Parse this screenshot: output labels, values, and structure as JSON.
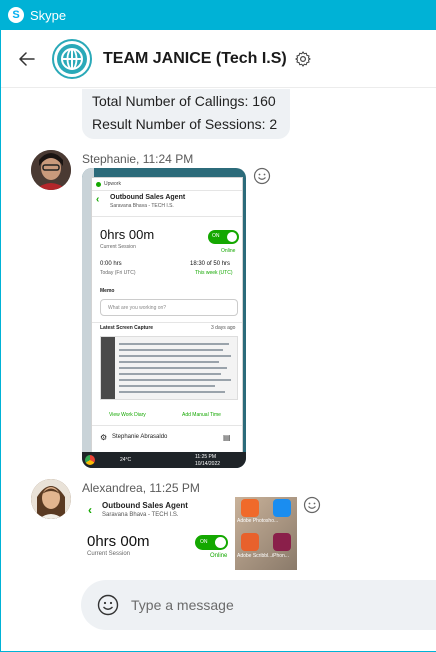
{
  "window": {
    "app_title": "Skype",
    "logo_letter": "S"
  },
  "header": {
    "group_name": "TEAM JANICE (Tech I.S)"
  },
  "previous_message": {
    "lines": [
      "Total Number of Callings: 160",
      "Result Number of Sessions: 2"
    ]
  },
  "messages": [
    {
      "sender": "Stephanie, 11:24 PM",
      "screenshot": {
        "app": "Upwork",
        "job_title": "Outbound Sales Agent",
        "company": "Saravana Bhava - TECH I.S.",
        "hours": "0hrs 00m",
        "current_session": "Current Session",
        "toggle": "ON",
        "status": "Online",
        "today_hours": "0:00 hrs",
        "today_label": "Today (Fri UTC)",
        "week_hours": "18:30 of 50 hrs",
        "week_label": "This week (UTC)",
        "memo_label": "Memo",
        "memo_placeholder": "What are you working on?",
        "capture_label": "Latest Screen Capture",
        "capture_ago": "3 days ago",
        "view_diary": "View Work Diary",
        "add_manual": "Add Manual Time",
        "user_name": "Stephanie Abrasaldo",
        "taskbar_temp": "24°C",
        "taskbar_time": "11:25 PM",
        "taskbar_date": "10/14/2022"
      }
    },
    {
      "sender": "Alexandrea, 11:25 PM",
      "screenshot": {
        "job_title": "Outbound Sales Agent",
        "company": "Saravana Bhava - TECH I.S.",
        "hours": "0hrs 00m",
        "current_session": "Current Session",
        "toggle": "ON",
        "status": "Online",
        "desktop_labels": [
          "Adobe Photosho...",
          "iPhon...",
          "Adobe Scribbl..."
        ]
      }
    }
  ],
  "composer": {
    "placeholder": "Type a message"
  },
  "colors": {
    "titlebar": "#00b2d6",
    "upwork_green": "#14a800",
    "accent_teal": "#2aa9b8"
  }
}
